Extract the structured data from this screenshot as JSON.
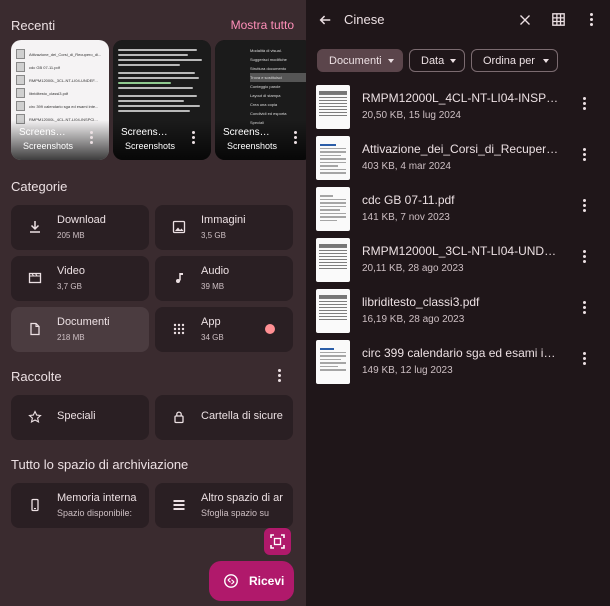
{
  "left": {
    "recents_title": "Recenti",
    "show_all": "Mostra tutto",
    "recents": [
      {
        "name": "Screens…",
        "source": "Screenshots",
        "doc_lines": [
          "Attivazione_dei_Corsi_di_Recupero_di...",
          "cdc GB 07-11.pdf",
          "RMPM12000L_3CL-NT-LI04-UNDEF...",
          "libriditesto_classi3.pdf",
          "circ 399 calendario sga ed esami inte...",
          "RMPM12000L_4CL-NT-LI04-INSPCI..."
        ]
      },
      {
        "name": "Screens…",
        "source": "Screenshots"
      },
      {
        "name": "Screens…",
        "source": "Screenshots",
        "menu_items": [
          "Modalità di visual.",
          "Suggerisci modifiche",
          "Struttura documento",
          "Trova e sostituisci",
          "Conteggio parole",
          "Layout di stampa",
          "Crea una copia",
          "Condividi ed esporta",
          "Speciali"
        ]
      }
    ],
    "categories_title": "Categorie",
    "categories": [
      {
        "name": "Download",
        "size": "205 MB",
        "icon": "download-icon"
      },
      {
        "name": "Immagini",
        "size": "3,5 GB",
        "icon": "image-icon"
      },
      {
        "name": "Video",
        "size": "3,7 GB",
        "icon": "video-icon"
      },
      {
        "name": "Audio",
        "size": "39 MB",
        "icon": "music-note-icon"
      },
      {
        "name": "Documenti",
        "size": "218 MB",
        "icon": "document-icon",
        "selected": true
      },
      {
        "name": "App",
        "size": "34 GB",
        "icon": "apps-grid-icon"
      }
    ],
    "collections_title": "Raccolte",
    "collections": [
      {
        "name": "Speciali",
        "icon": "star-icon"
      },
      {
        "name": "Cartella di sicure",
        "icon": "lock-icon"
      }
    ],
    "storage_title": "Tutto lo spazio di archiviazione",
    "storage": [
      {
        "name": "Memoria interna",
        "sub": "Spazio disponibile: ",
        "icon": "phone-icon"
      },
      {
        "name": "Altro spazio di ar",
        "sub": "Sfoglia spazio su",
        "icon": "storage-icon"
      }
    ],
    "fab_label": "Ricevi",
    "accent": "#b0196b",
    "link_color": "#ff8fb9"
  },
  "right": {
    "search_query": "Cinese",
    "chips": [
      {
        "label": "Documenti",
        "selected": true
      },
      {
        "label": "Data",
        "selected": false
      },
      {
        "label": "Ordina per",
        "selected": false
      }
    ],
    "files": [
      {
        "name": "RMPM12000L_4CL-NT-LI04-INSPCI...",
        "meta": "20,50 KB, 15 lug 2024",
        "thumb": "table"
      },
      {
        "name": "Attivazione_dei_Corsi_di_Recupero_di...",
        "meta": "403 KB, 4 mar 2024",
        "thumb": "text"
      },
      {
        "name": "cdc GB 07-11.pdf",
        "meta": "141 KB, 7 nov 2023",
        "thumb": "text"
      },
      {
        "name": "RMPM12000L_3CL-NT-LI04-UNDEF....",
        "meta": "20,11 KB, 28 ago 2023",
        "thumb": "table"
      },
      {
        "name": "libriditesto_classi3.pdf",
        "meta": "16,19 KB, 28 ago 2023",
        "thumb": "table"
      },
      {
        "name": "circ 399 calendario sga ed esami inte...",
        "meta": "149 KB, 12 lug 2023",
        "thumb": "text"
      }
    ]
  }
}
